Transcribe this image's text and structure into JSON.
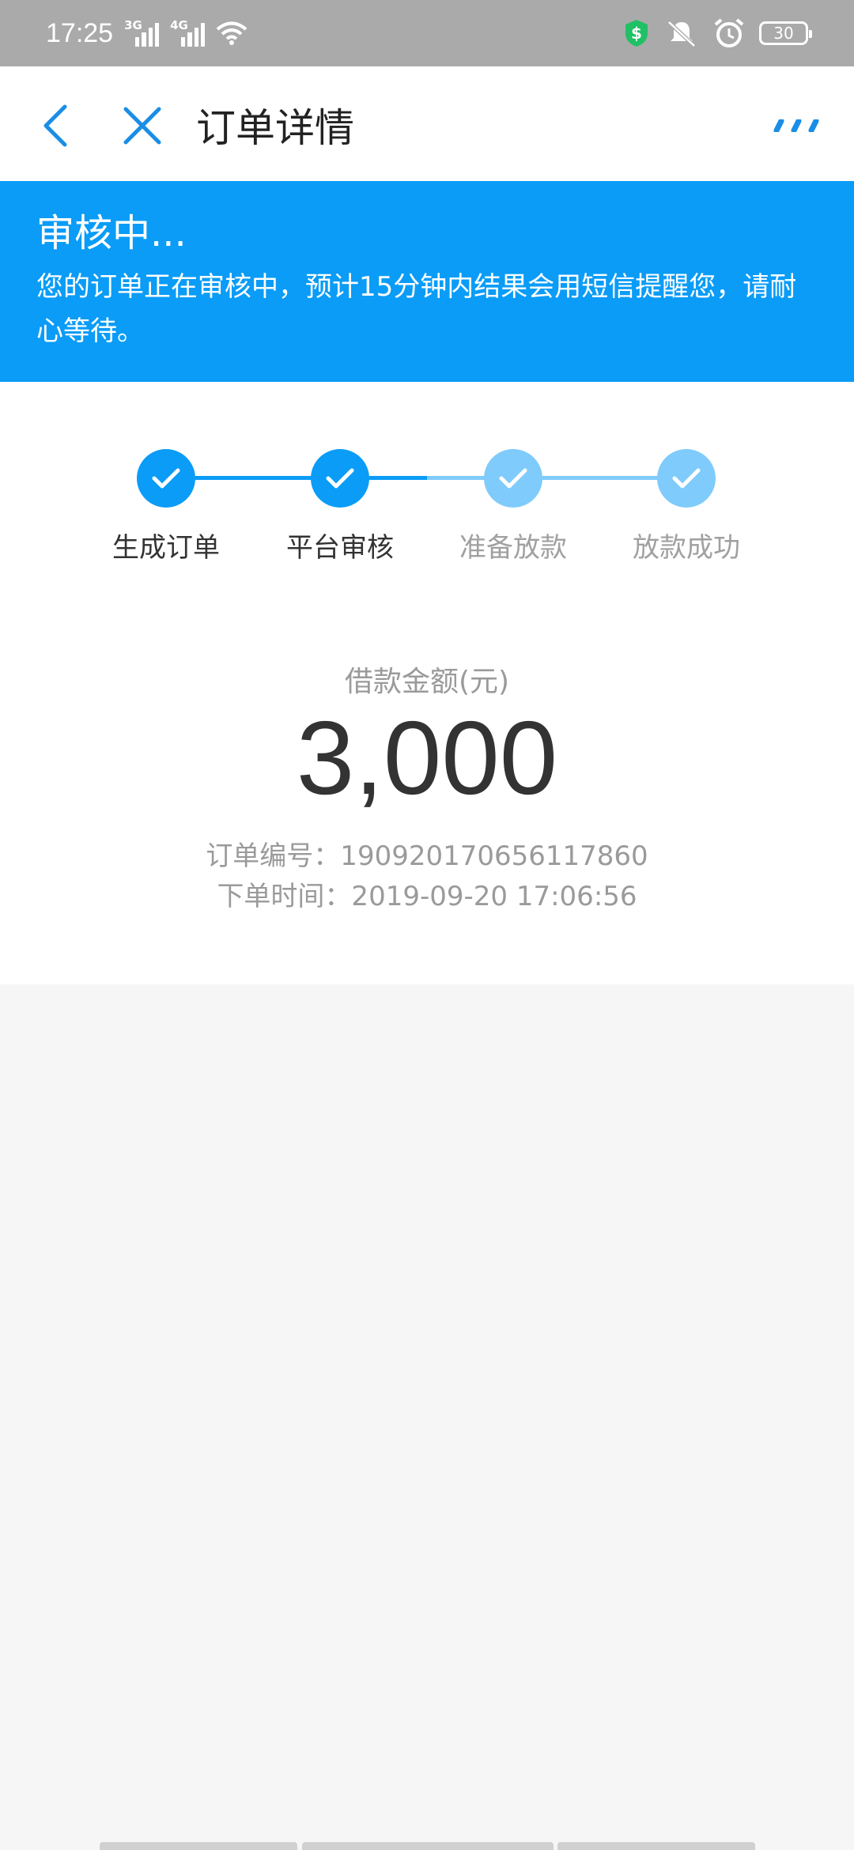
{
  "status_bar": {
    "time": "17:25",
    "net1": "3G",
    "net2": "4G",
    "battery": "30"
  },
  "nav": {
    "title": "订单详情"
  },
  "banner": {
    "title": "审核中...",
    "description": "您的订单正在审核中，预计15分钟内结果会用短信提醒您，请耐心等待。"
  },
  "steps": [
    {
      "label": "生成订单",
      "state": "done"
    },
    {
      "label": "平台审核",
      "state": "done"
    },
    {
      "label": "准备放款",
      "state": "pending"
    },
    {
      "label": "放款成功",
      "state": "pending"
    }
  ],
  "amount": {
    "label": "借款金额(元)",
    "value": "3,000"
  },
  "order": {
    "number_line": "订单编号：19092017065611786​0",
    "time_line": "下单时间：2019-09-20 17:06:56"
  },
  "colors": {
    "primary": "#0a9cf7",
    "step_pending": "#7fcbfb",
    "background": "#f6f6f6"
  }
}
